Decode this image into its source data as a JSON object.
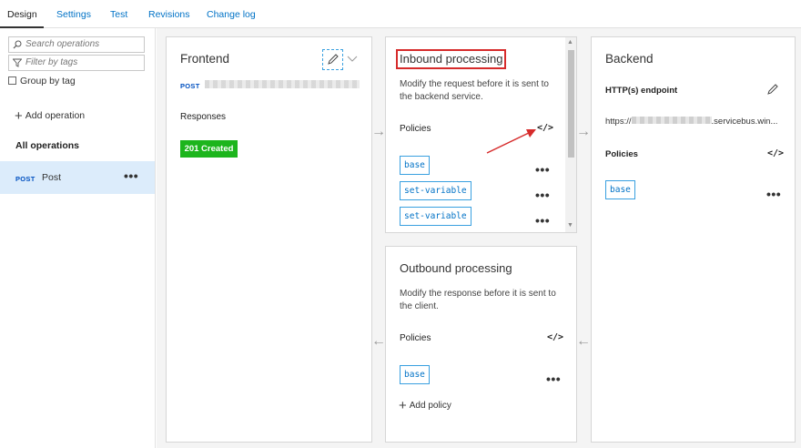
{
  "tabs": [
    {
      "label": "Design",
      "active": true
    },
    {
      "label": "Settings"
    },
    {
      "label": "Test"
    },
    {
      "label": "Revisions"
    },
    {
      "label": "Change log"
    }
  ],
  "sidebar": {
    "search_placeholder": "Search operations",
    "filter_placeholder": "Filter by tags",
    "group_by_tag": "Group by tag",
    "add_operation": "Add operation",
    "all_operations": "All operations",
    "operations": [
      {
        "method": "POST",
        "name": "Post",
        "selected": true
      }
    ]
  },
  "frontend": {
    "title": "Frontend",
    "method": "POST",
    "responses_label": "Responses",
    "response_badge": "201 Created"
  },
  "inbound": {
    "title": "Inbound processing",
    "description_line1": "Modify the request before it is sent to",
    "description_line2": "the backend service.",
    "policies_label": "Policies",
    "code_icon": "</>",
    "policies": [
      "base",
      "set-variable",
      "set-variable"
    ]
  },
  "outbound": {
    "title": "Outbound processing",
    "description_line1": "Modify the response before it is sent to",
    "description_line2": "the client.",
    "policies_label": "Policies",
    "code_icon": "</>",
    "policies": [
      "base"
    ],
    "add_policy": "Add policy"
  },
  "backend": {
    "title": "Backend",
    "endpoint_label": "HTTP(s) endpoint",
    "endpoint_prefix": "https://",
    "endpoint_suffix": ".servicebus.win...",
    "policies_label": "Policies",
    "code_icon": "</>",
    "policies": [
      "base"
    ]
  },
  "colors": {
    "accent": "#0072c6",
    "success_badge": "#1db51d",
    "highlight_box": "#d62b2b",
    "selected_row": "#dcecfb"
  }
}
